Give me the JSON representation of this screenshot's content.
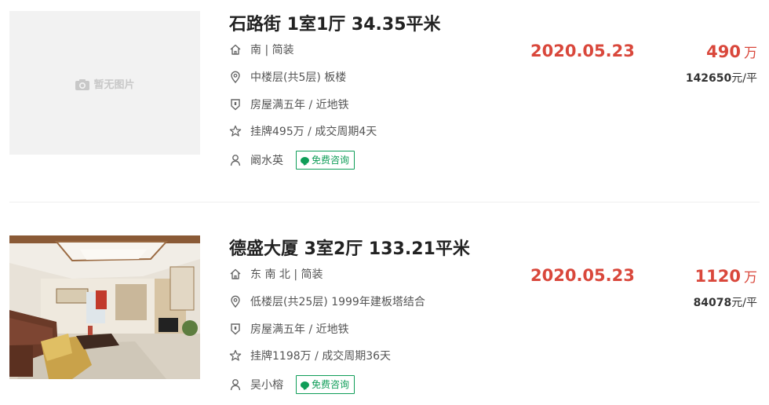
{
  "listings": [
    {
      "title": "石路街 1室1厅 34.35平米",
      "image": {
        "has_photo": false,
        "placeholder_text": "暂无图片"
      },
      "orientation_decoration": "南 | 简装",
      "floor_info": "中楼层(共5层) 板楼",
      "tags": "房屋满五年 / 近地铁",
      "listing_info": "挂牌495万 / 成交周期4天",
      "agent": "阚水英",
      "consult_label": "免费咨询",
      "deal_date": "2020.05.23",
      "total_price": "490",
      "total_price_unit": "万",
      "unit_price": "142650",
      "unit_price_suffix": "元/平"
    },
    {
      "title": "德盛大厦 3室2厅 133.21平米",
      "image": {
        "has_photo": true
      },
      "orientation_decoration": "东 南 北 | 简装",
      "floor_info": "低楼层(共25层) 1999年建板塔结合",
      "tags": "房屋满五年 / 近地铁",
      "listing_info": "挂牌1198万 / 成交周期36天",
      "agent": "吴小榕",
      "consult_label": "免费咨询",
      "deal_date": "2020.05.23",
      "total_price": "1120",
      "total_price_unit": "万",
      "unit_price": "84078",
      "unit_price_suffix": "元/平"
    }
  ],
  "colors": {
    "accent_red": "#d9473b",
    "consult_green": "#0f9d58",
    "icon_gray": "#666666"
  },
  "icons": [
    "house-icon",
    "location-pin-icon",
    "shield-icon",
    "star-icon",
    "person-icon",
    "camera-icon",
    "chat-bubble-icon"
  ]
}
